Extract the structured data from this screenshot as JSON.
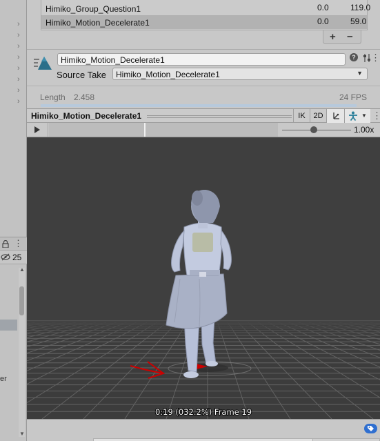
{
  "clip_list": {
    "rows": [
      {
        "name": "Himiko_Group_Question1",
        "start": "0.0",
        "end": "119.0",
        "selected": false
      },
      {
        "name": "Himiko_Motion_Decelerate1",
        "start": "0.0",
        "end": "59.0",
        "selected": true
      }
    ],
    "add_label": "+",
    "remove_label": "−"
  },
  "clip_settings": {
    "name": "Himiko_Motion_Decelerate1",
    "source_take_label": "Source Take",
    "source_take_value": "Himiko_Motion_Decelerate1",
    "help_glyph": "?",
    "kebab_glyph": "⋮",
    "length_label": "Length",
    "length_value": "2.458",
    "fps": "24 FPS"
  },
  "preview": {
    "title": "Himiko_Motion_Decelerate1",
    "ik_label": "IK",
    "two_d_label": "2D",
    "kebab_glyph": "⋮",
    "speed": "1.00x",
    "speed_fraction": 0.5,
    "status": "0:19 (032.2%) Frame 19",
    "playhead_fraction": 0.322
  },
  "left_panel": {
    "visibility_count": "25",
    "fragment_text": "er"
  },
  "colors": {
    "viewport_bg": "#3d3d3d",
    "accent": "#2f6fd0",
    "selected_row": "#b2b2b2"
  },
  "icons": [
    "chevron-right-icon",
    "animation-clip-icon",
    "help-icon",
    "settings-icon",
    "play-icon",
    "pivot-icon",
    "avatar-icon",
    "tag-icon",
    "lock-icon",
    "eye-hidden-icon"
  ]
}
